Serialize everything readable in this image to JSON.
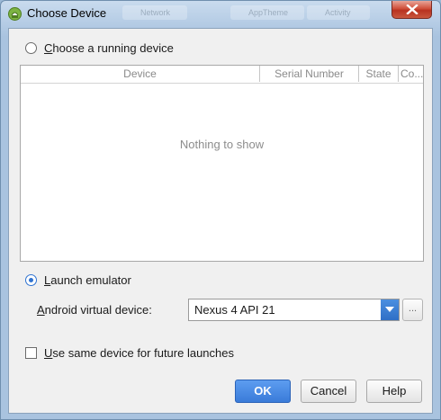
{
  "window": {
    "title": "Choose Device",
    "background_tab_labels": [
      "Network",
      "AppTheme",
      "Activity"
    ]
  },
  "running_device": {
    "radio_label_mnemonic": "C",
    "radio_label_rest": "hoose a running device",
    "selected": false,
    "table": {
      "columns": [
        "Device",
        "Serial Number",
        "State",
        "Co..."
      ],
      "empty_text": "Nothing to show"
    }
  },
  "emulator": {
    "radio_label_mnemonic": "L",
    "radio_label_rest": "aunch emulator",
    "selected": true,
    "avd_label_mnemonic": "A",
    "avd_label_rest": "ndroid virtual device:",
    "avd_value": "Nexus 4 API 21",
    "browse_label": "..."
  },
  "same_device": {
    "label_mnemonic": "U",
    "label_rest": "se same device for future launches",
    "checked": false
  },
  "buttons": {
    "ok": "OK",
    "cancel": "Cancel",
    "help": "Help"
  },
  "colors": {
    "accent": "#3a7bd9",
    "close": "#c9563e",
    "title_bar": "#a9c3df"
  },
  "icons": {
    "app": "android-studio-icon",
    "close": "close-icon",
    "dropdown": "chevron-down-icon"
  }
}
